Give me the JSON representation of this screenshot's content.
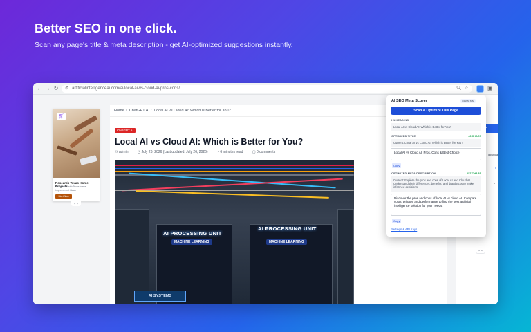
{
  "hero": {
    "title": "Better SEO in one click.",
    "subtitle": "Scan any page's title & meta description - get AI-optimized suggestions instantly."
  },
  "browser": {
    "url": "artificialintelligenceai.com/ai/local-ai-vs-cloud-ai-pros-cons/",
    "nav": {
      "back": "←",
      "forward": "→",
      "reload": "↻"
    }
  },
  "ad": {
    "title": "Research Texas Home Projects",
    "description": "Get started with Texas home improvement ideas",
    "button": "Start Now"
  },
  "article": {
    "breadcrumb": [
      "Home",
      "ChatGPT AI",
      "Local AI vs Cloud AI: Which is Better for You?"
    ],
    "category": "ChatGPT AI",
    "title": "Local AI vs Cloud AI: Which is Better for You?",
    "meta": {
      "author": "admin",
      "date": "July 26, 2026 (Last updated: July 26, 2026)",
      "read_time": "6 minutes read",
      "comments": "0 comments"
    },
    "image_labels": {
      "rack1": "AI PROCESSING UNIT",
      "rack1_sub": "MACHINE LEARNING",
      "rack2": "AI PROCESSING UNIT",
      "rack2_sub": "MACHINE LEARNING",
      "screen": "AI SYSTEMS"
    }
  },
  "right_strip": {
    "button": "d",
    "text1": "download",
    "text2": "y",
    "text3": "n"
  },
  "popup": {
    "title": "AI SEO Meta Scorer",
    "badge": "55606 MM",
    "scan_button": "Scan & Optimize This Page",
    "h1_label": "H1 HEADING",
    "h1_value": "Local AI vs Cloud AI: Which is Better for You?",
    "opt_title_label": "OPTIMIZED TITLE",
    "opt_title_count": "46 CHARS",
    "current_title": "Current: Local AI vs Cloud AI: Which is Better for You?",
    "opt_title_value": "Local AI vs Cloud AI: Pros, Cons & Best Choice",
    "copy1": "Copy",
    "opt_meta_label": "OPTIMIZED META DESCRIPTION",
    "opt_meta_count": "157 CHARS",
    "current_meta": "Current: Explore the pros and cons of Local AI and Cloud AI. Understand their differences, benefits, and drawbacks to make informed decisions.",
    "opt_meta_value": "Discover the pros and cons of local AI vs cloud AI. Compare costs, privacy, and performance to find the best artificial intelligence solution for your needs.",
    "copy2": "Copy",
    "settings_link": "Settings & API Keys"
  },
  "colors": {
    "accent": "#1d4ed8",
    "badge_red": "#dc2626",
    "count_green": "#16a34a"
  }
}
